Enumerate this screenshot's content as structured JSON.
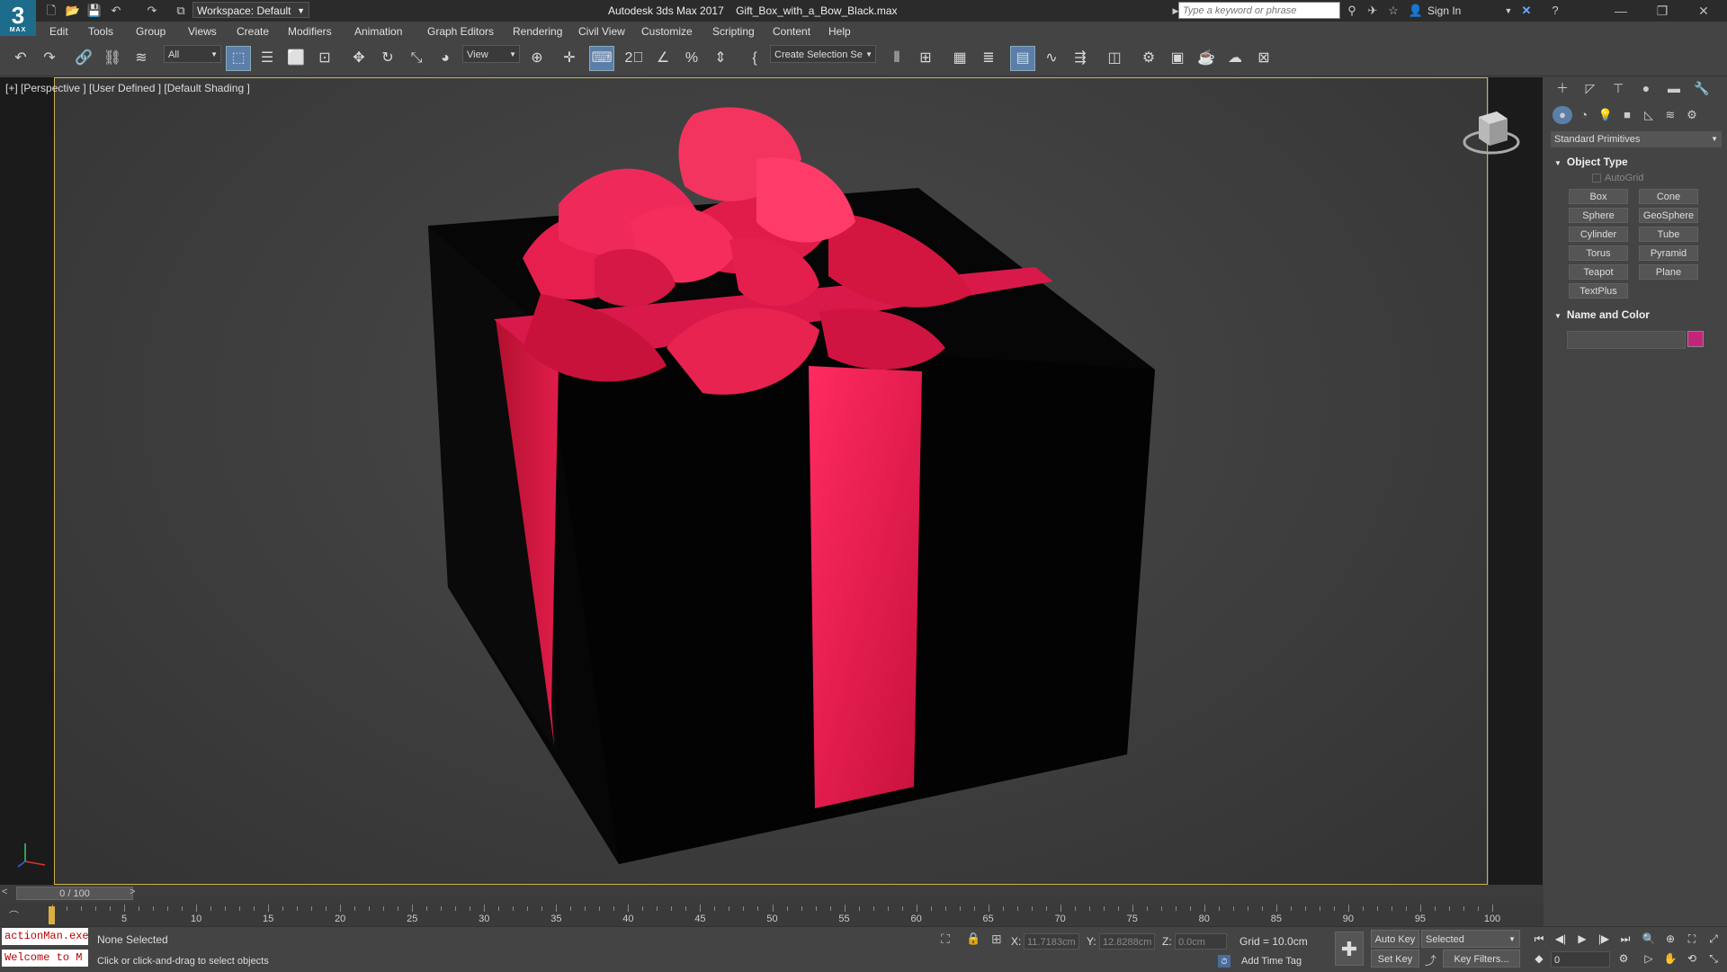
{
  "app": {
    "logo_number": "3",
    "logo_text": "MAX",
    "title": "Autodesk 3ds Max 2017",
    "filename": "Gift_Box_with_a_Bow_Black.max",
    "workspace": "Workspace: Default",
    "search_placeholder": "Type a keyword or phrase",
    "sign_in": "Sign In"
  },
  "menu": [
    "Edit",
    "Tools",
    "Group",
    "Views",
    "Create",
    "Modifiers",
    "Animation",
    "Graph Editors",
    "Rendering",
    "Civil View",
    "Customize",
    "Scripting",
    "Content",
    "Help"
  ],
  "toolbar": {
    "filter_value": "All",
    "refcoord_value": "View",
    "selection_set_placeholder": "Create Selection Se"
  },
  "viewport": {
    "label": "[+] [Perspective ] [User Defined ] [Default Shading ]"
  },
  "command_panel": {
    "dropdown": "Standard Primitives",
    "object_type_title": "Object Type",
    "autogrid": "AutoGrid",
    "buttons": [
      "Box",
      "Cone",
      "Sphere",
      "GeoSphere",
      "Cylinder",
      "Tube",
      "Torus",
      "Pyramid",
      "Teapot",
      "Plane",
      "TextPlus"
    ],
    "name_color_title": "Name and Color",
    "swatch_color": "#c3257a"
  },
  "timeline": {
    "slider_label": "0 / 100",
    "tick_labels": [
      "0",
      "5",
      "10",
      "15",
      "20",
      "25",
      "30",
      "35",
      "40",
      "45",
      "50",
      "55",
      "60",
      "65",
      "70",
      "75",
      "80",
      "85",
      "90",
      "95",
      "100"
    ]
  },
  "status": {
    "maxscript_1": "actionMan.exe",
    "maxscript_2": "Welcome to M",
    "selection": "None Selected",
    "prompt": "Click or click-and-drag to select objects",
    "x_label": "X:",
    "x_value": "11.7183cm",
    "y_label": "Y:",
    "y_value": "12.8288cm",
    "z_label": "Z:",
    "z_value": "0.0cm",
    "grid": "Grid = 10.0cm",
    "add_time_tag": "Add Time Tag",
    "auto_key": "Auto Key",
    "set_key": "Set Key",
    "selected_dropdown": "Selected",
    "key_filters": "Key Filters...",
    "frame_value": "0"
  },
  "colors": {
    "ribbon": "#d81e4a",
    "box": "#050505",
    "viewport_border": "#c9b24b"
  }
}
